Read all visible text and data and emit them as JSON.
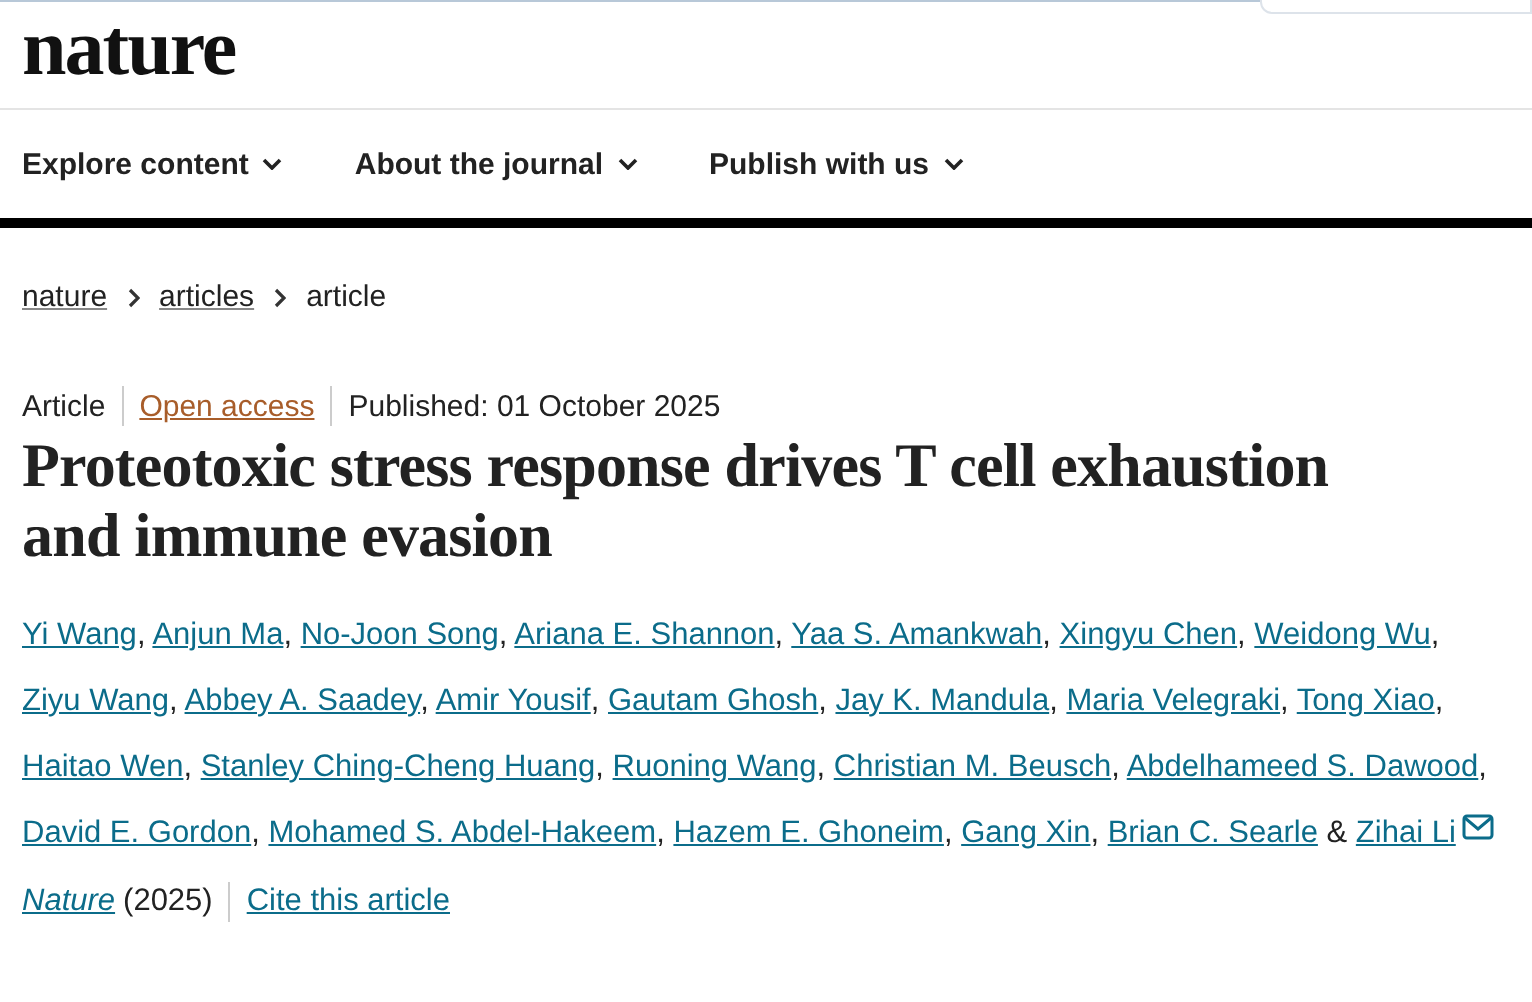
{
  "logo": "nature",
  "nav": [
    {
      "label": "Explore content"
    },
    {
      "label": "About the journal"
    },
    {
      "label": "Publish with us"
    }
  ],
  "breadcrumbs": [
    {
      "label": "nature",
      "link": true
    },
    {
      "label": "articles",
      "link": true
    },
    {
      "label": "article",
      "link": false
    }
  ],
  "meta": {
    "type": "Article",
    "access": "Open access",
    "published": "Published: 01 October 2025"
  },
  "title": "Proteotoxic stress response drives T cell exhaustion and immune evasion",
  "authors": [
    {
      "name": "Yi Wang",
      "after": ","
    },
    {
      "name": "Anjun Ma",
      "after": ","
    },
    {
      "name": "No-Joon Song",
      "after": ","
    },
    {
      "name": "Ariana E. Shannon",
      "after": ","
    },
    {
      "name": "Yaa S. Amankwah",
      "after": ","
    },
    {
      "name": "Xingyu Chen",
      "after": ","
    },
    {
      "name": "Weidong Wu",
      "after": ","
    },
    {
      "name": "Ziyu Wang",
      "after": ","
    },
    {
      "name": "Abbey A. Saadey",
      "after": ","
    },
    {
      "name": "Amir Yousif",
      "after": ","
    },
    {
      "name": "Gautam Ghosh",
      "after": ","
    },
    {
      "name": "Jay K. Mandula",
      "after": ","
    },
    {
      "name": "Maria Velegraki",
      "after": ","
    },
    {
      "name": "Tong Xiao",
      "after": ","
    },
    {
      "name": "Haitao Wen",
      "after": ","
    },
    {
      "name": "Stanley Ching-Cheng Huang",
      "after": ","
    },
    {
      "name": "Ruoning Wang",
      "after": ","
    },
    {
      "name": "Christian M. Beusch",
      "after": ","
    },
    {
      "name": "Abdelhameed S. Dawood",
      "after": ","
    },
    {
      "name": "David E. Gordon",
      "after": ","
    },
    {
      "name": "Mohamed S. Abdel-Hakeem",
      "after": ","
    },
    {
      "name": "Hazem E. Ghoneim",
      "after": ","
    },
    {
      "name": "Gang Xin",
      "after": ","
    },
    {
      "name": "Brian C. Searle",
      "after": "&"
    },
    {
      "name": "Zihai Li",
      "email": true
    }
  ],
  "citation": {
    "journal": "Nature",
    "year": "(2025)",
    "cite": "Cite this article"
  }
}
